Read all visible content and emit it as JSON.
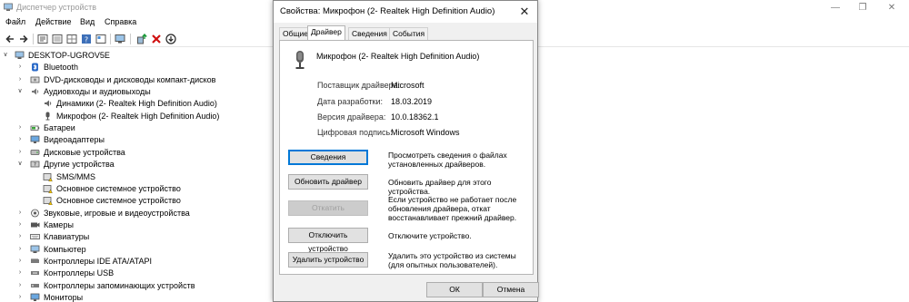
{
  "window": {
    "title": "Диспетчер устройств",
    "controls": {
      "minimize": "—",
      "maximize": "❐",
      "close": "✕"
    }
  },
  "menu": [
    "Файл",
    "Действие",
    "Вид",
    "Справка"
  ],
  "toolbar": [
    "back-icon",
    "forward-icon",
    "properties-icon",
    "list-icon",
    "help-icon",
    "view-icon",
    "monitor-icon",
    "update-driver-icon",
    "uninstall-icon",
    "scan-icon"
  ],
  "tree": [
    {
      "label": "DESKTOP-UGROV5E",
      "level": 0,
      "expand": "∨",
      "icon": "computer"
    },
    {
      "label": "Bluetooth",
      "level": 1,
      "expand": "›",
      "icon": "bluetooth"
    },
    {
      "label": "DVD-дисководы и дисководы компакт-дисков",
      "level": 1,
      "expand": "›",
      "icon": "dvd"
    },
    {
      "label": "Аудиовходы и аудиовыходы",
      "level": 1,
      "expand": "∨",
      "icon": "audio"
    },
    {
      "label": "Динамики (2- Realtek High Definition Audio)",
      "level": 2,
      "expand": "",
      "icon": "speaker"
    },
    {
      "label": "Микрофон (2- Realtek High Definition Audio)",
      "level": 2,
      "expand": "",
      "icon": "mic"
    },
    {
      "label": "Батареи",
      "level": 1,
      "expand": "›",
      "icon": "battery"
    },
    {
      "label": "Видеоадаптеры",
      "level": 1,
      "expand": "›",
      "icon": "display"
    },
    {
      "label": "Дисковые устройства",
      "level": 1,
      "expand": "›",
      "icon": "disk"
    },
    {
      "label": "Другие устройства",
      "level": 1,
      "expand": "∨",
      "icon": "other"
    },
    {
      "label": "SMS/MMS",
      "level": 2,
      "expand": "",
      "icon": "unknown"
    },
    {
      "label": "Основное системное устройство",
      "level": 2,
      "expand": "",
      "icon": "unknown"
    },
    {
      "label": "Основное системное устройство",
      "level": 2,
      "expand": "",
      "icon": "unknown"
    },
    {
      "label": "Звуковые, игровые и видеоустройства",
      "level": 1,
      "expand": "›",
      "icon": "sound"
    },
    {
      "label": "Камеры",
      "level": 1,
      "expand": "›",
      "icon": "camera"
    },
    {
      "label": "Клавиатуры",
      "level": 1,
      "expand": "›",
      "icon": "keyboard"
    },
    {
      "label": "Компьютер",
      "level": 1,
      "expand": "›",
      "icon": "computer"
    },
    {
      "label": "Контроллеры IDE ATA/ATAPI",
      "level": 1,
      "expand": "›",
      "icon": "ide"
    },
    {
      "label": "Контроллеры USB",
      "level": 1,
      "expand": "›",
      "icon": "usb"
    },
    {
      "label": "Контроллеры запоминающих устройств",
      "level": 1,
      "expand": "›",
      "icon": "storage"
    },
    {
      "label": "Мониторы",
      "level": 1,
      "expand": "›",
      "icon": "display"
    }
  ],
  "dialog": {
    "title": "Свойства: Микрофон (2- Realtek High Definition Audio)",
    "close": "✕",
    "tabs": [
      "Общие",
      "Драйвер",
      "Сведения",
      "События"
    ],
    "active_tab": "Драйвер",
    "device_name": "Микрофон (2- Realtek High Definition Audio)",
    "properties": [
      {
        "label": "Поставщик драйвера:",
        "value": "Microsoft"
      },
      {
        "label": "Дата разработки:",
        "value": "18.03.2019"
      },
      {
        "label": "Версия драйвера:",
        "value": "10.0.18362.1"
      },
      {
        "label": "Цифровая подпись:",
        "value": "Microsoft Windows"
      }
    ],
    "actions": [
      {
        "button": "Сведения",
        "description": "Просмотреть сведения о файлах установленных драйверов."
      },
      {
        "button": "Обновить драйвер",
        "description": "Обновить драйвер для этого устройства."
      },
      {
        "button": "Откатить",
        "description": "Если устройство не работает после обновления драйвера, откат восстанавливает прежний драйвер."
      },
      {
        "button": "Отключить устройство",
        "description": "Отключите устройство."
      },
      {
        "button": "Удалить устройство",
        "description": "Удалить это устройство из системы (для опытных пользователей)."
      }
    ],
    "ok": "ОК",
    "cancel": "Отмена"
  },
  "colors": {
    "accent": "#0078d7",
    "disabled": "#a0a0a0"
  }
}
